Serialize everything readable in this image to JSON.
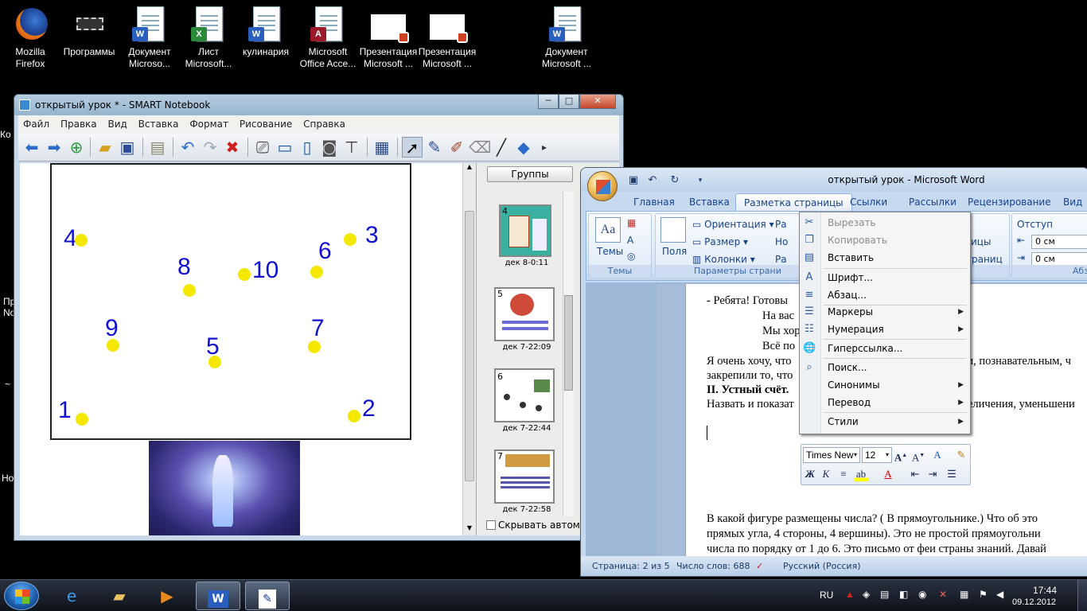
{
  "desktop": {
    "icons": [
      {
        "line1": "Mozilla",
        "line2": "Firefox"
      },
      {
        "line1": "Программы",
        "line2": ""
      },
      {
        "line1": "Документ",
        "line2": "Microso..."
      },
      {
        "line1": "Лист",
        "line2": "Microsoft..."
      },
      {
        "line1": "кулинария",
        "line2": ""
      },
      {
        "line1": "Microsoft",
        "line2": "Office Acce..."
      },
      {
        "line1": "Презентация",
        "line2": "Microsoft ..."
      },
      {
        "line1": "Презентация",
        "line2": "Microsoft ..."
      },
      {
        "line1": "Документ",
        "line2": "Microsoft ..."
      }
    ],
    "left_edge": [
      "Ко",
      "Пр",
      "No",
      "~",
      "Но"
    ]
  },
  "smart": {
    "title": "открытый урок * - SMART Notebook",
    "menu": [
      "Файл",
      "Правка",
      "Вид",
      "Вставка",
      "Формат",
      "Рисование",
      "Справка"
    ],
    "groups_button": "Группы",
    "page_numbers": [
      "1",
      "2",
      "3",
      "4",
      "5",
      "6",
      "7",
      "8",
      "9",
      "10"
    ],
    "thumbs": [
      {
        "num": "4",
        "caption": "дек 8-0:11"
      },
      {
        "num": "5",
        "caption": "дек 7-22:09"
      },
      {
        "num": "6",
        "caption": "дек 7-22:44"
      },
      {
        "num": "7",
        "caption": "дек 7-22:58"
      }
    ],
    "autohide_label": "Скрывать автомат"
  },
  "word": {
    "title": "открытый урок - Microsoft Word",
    "tabs": [
      "Главная",
      "Вставка",
      "Разметка страницы",
      "Ссылки",
      "Рассылки",
      "Рецензирование",
      "Вид"
    ],
    "ribbon": {
      "themes": "Темы",
      "themes_group": "Темы",
      "fields": "Поля",
      "orientation": "Ориентация",
      "size": "Размер",
      "columns": "Колонки",
      "page_params_group": "Параметры страни",
      "r1": "Ра",
      "r2": "Но",
      "r3": "Ра",
      "abz1": "ицы",
      "abz2": "траниц",
      "indent_label": "Отступ",
      "indent_left": "0 см",
      "indent_right": "0 см",
      "abz_group": "Абз"
    },
    "doc_lines": [
      "- Ребята!   Готовы",
      "На вас",
      "Мы хор",
      "Всё по",
      "Я очень хочу, что",
      "м, познавательным, ч",
      "закрепили то, что",
      "II. Устный счёт.",
      "Назвать и показат",
      "еличения, уменьшени",
      "В какой фигуре размещены числа? ( В прямоугольнике.)  Что об это",
      "прямых угла, 4 стороны, 4 вершины). Это не простой прямоугольни",
      "числа по порядку от 1 до 6. Это письмо от  феи страны знаний. Давай"
    ],
    "status": {
      "page": "Страница: 2 из 5",
      "words": "Число слов: 688",
      "lang": "Русский (Россия)"
    }
  },
  "context_menu": [
    {
      "label": "Вырезать",
      "icon": "scissors-icon",
      "disabled": true,
      "submenu": false
    },
    {
      "label": "Копировать",
      "icon": "copy-icon",
      "disabled": true,
      "submenu": false
    },
    {
      "label": "Вставить",
      "icon": "paste-icon",
      "disabled": false,
      "submenu": false
    },
    {
      "label": "Шрифт...",
      "icon": "font-icon",
      "disabled": false,
      "submenu": false
    },
    {
      "label": "Абзац...",
      "icon": "paragraph-icon",
      "disabled": false,
      "submenu": false
    },
    {
      "label": "Маркеры",
      "icon": "bullets-icon",
      "disabled": false,
      "submenu": true
    },
    {
      "label": "Нумерация",
      "icon": "numbering-icon",
      "disabled": false,
      "submenu": true
    },
    {
      "label": "Гиперссылка...",
      "icon": "hyperlink-icon",
      "disabled": false,
      "submenu": false
    },
    {
      "label": "Поиск...",
      "icon": "research-icon",
      "disabled": false,
      "submenu": false
    },
    {
      "label": "Синонимы",
      "icon": "",
      "disabled": false,
      "submenu": true
    },
    {
      "label": "Перевод",
      "icon": "",
      "disabled": false,
      "submenu": true
    },
    {
      "label": "Стили",
      "icon": "",
      "disabled": false,
      "submenu": true
    }
  ],
  "mini_toolbar": {
    "font": "Times New",
    "size": "12"
  },
  "taskbar": {
    "lang": "RU",
    "time": "17:44",
    "date": "09.12.2012"
  },
  "colors": {
    "dot": "#f5e800",
    "digit": "#1010d0",
    "word_blue": "#15428b"
  }
}
